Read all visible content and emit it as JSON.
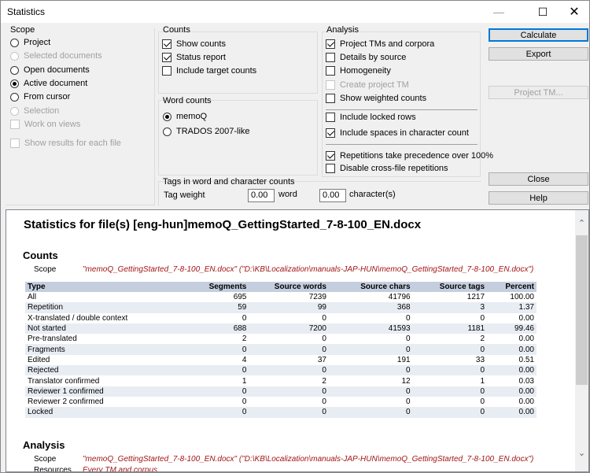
{
  "window": {
    "title": "Statistics",
    "minimize": "—",
    "maximize": "☐",
    "close": "✕"
  },
  "scope": {
    "title": "Scope",
    "options": [
      {
        "label": "Project",
        "type": "radio",
        "checked": false,
        "enabled": true
      },
      {
        "label": "Selected documents",
        "type": "radio",
        "checked": false,
        "enabled": false
      },
      {
        "label": "Open documents",
        "type": "radio",
        "checked": false,
        "enabled": true
      },
      {
        "label": "Active document",
        "type": "radio",
        "checked": true,
        "enabled": true
      },
      {
        "label": "From cursor",
        "type": "radio",
        "checked": false,
        "enabled": true
      },
      {
        "label": "Selection",
        "type": "radio",
        "checked": false,
        "enabled": false
      },
      {
        "label": "Work on views",
        "type": "checkbox",
        "checked": false,
        "enabled": false
      },
      {
        "label": "Show results for each file",
        "type": "checkbox",
        "checked": false,
        "enabled": false
      }
    ]
  },
  "counts": {
    "title": "Counts",
    "options": [
      {
        "label": "Show counts",
        "checked": true
      },
      {
        "label": "Status report",
        "checked": true
      },
      {
        "label": "Include target counts",
        "checked": false
      }
    ]
  },
  "word_counts": {
    "title": "Word counts",
    "options": [
      {
        "label": "memoQ",
        "checked": true
      },
      {
        "label": "TRADOS 2007-like",
        "checked": false
      }
    ]
  },
  "tags": {
    "title": "Tags in word and character counts",
    "tag_weight_label": "Tag weight",
    "word_value": "0.00",
    "word_unit": "word",
    "char_value": "0.00",
    "char_unit": "character(s)"
  },
  "analysis": {
    "title": "Analysis",
    "options": [
      {
        "label": "Project TMs and corpora",
        "checked": true,
        "enabled": true
      },
      {
        "label": "Details by source",
        "checked": false,
        "enabled": true
      },
      {
        "label": "Homogeneity",
        "checked": false,
        "enabled": true
      },
      {
        "label": "Create project TM",
        "checked": false,
        "enabled": false
      },
      {
        "label": "Show weighted counts",
        "checked": false,
        "enabled": true
      },
      {
        "label": "Include locked rows",
        "checked": false,
        "enabled": true
      },
      {
        "label": "Include spaces in character count",
        "checked": true,
        "enabled": true
      },
      {
        "label": "Repetitions take precedence over 100%",
        "checked": true,
        "enabled": true
      },
      {
        "label": "Disable cross-file repetitions",
        "checked": false,
        "enabled": true
      }
    ]
  },
  "buttons": {
    "calculate": "Calculate",
    "export": "Export",
    "project_tm": "Project TM...",
    "close": "Close",
    "help": "Help"
  },
  "report": {
    "title": "Statistics for file(s) [eng-hun]memoQ_GettingStarted_7-8-100_EN.docx",
    "counts_heading": "Counts",
    "scope_label": "Scope",
    "scope_value": "\"memoQ_GettingStarted_7-8-100_EN.docx\" (\"D:\\KB\\Localization\\manuals-JAP-HUN\\memoQ_GettingStarted_7-8-100_EN.docx\")",
    "table": {
      "headers": [
        "Type",
        "Segments",
        "Source words",
        "Source chars",
        "Source tags",
        "Percent"
      ],
      "rows": [
        [
          "All",
          "695",
          "7239",
          "41796",
          "1217",
          "100.00"
        ],
        [
          "Repetition",
          "59",
          "99",
          "368",
          "3",
          "1.37"
        ],
        [
          "X-translated / double context",
          "0",
          "0",
          "0",
          "0",
          "0.00"
        ],
        [
          "Not started",
          "688",
          "7200",
          "41593",
          "1181",
          "99.46"
        ],
        [
          "Pre-translated",
          "2",
          "0",
          "0",
          "2",
          "0.00"
        ],
        [
          "Fragments",
          "0",
          "0",
          "0",
          "0",
          "0.00"
        ],
        [
          "Edited",
          "4",
          "37",
          "191",
          "33",
          "0.51"
        ],
        [
          "Rejected",
          "0",
          "0",
          "0",
          "0",
          "0.00"
        ],
        [
          "Translator confirmed",
          "1",
          "2",
          "12",
          "1",
          "0.03"
        ],
        [
          "Reviewer 1 confirmed",
          "0",
          "0",
          "0",
          "0",
          "0.00"
        ],
        [
          "Reviewer 2 confirmed",
          "0",
          "0",
          "0",
          "0",
          "0.00"
        ],
        [
          "Locked",
          "0",
          "0",
          "0",
          "0",
          "0.00"
        ]
      ]
    },
    "analysis_heading": "Analysis",
    "analysis_scope_label": "Scope",
    "analysis_scope_value": "\"memoQ_GettingStarted_7-8-100_EN.docx\" (\"D:\\KB\\Localization\\manuals-JAP-HUN\\memoQ_GettingStarted_7-8-100_EN.docx\")",
    "resources_label": "Resources",
    "resources_value": "Every TM and corpus"
  },
  "scrollbar": {
    "up": "⌃",
    "down": "⌄"
  }
}
